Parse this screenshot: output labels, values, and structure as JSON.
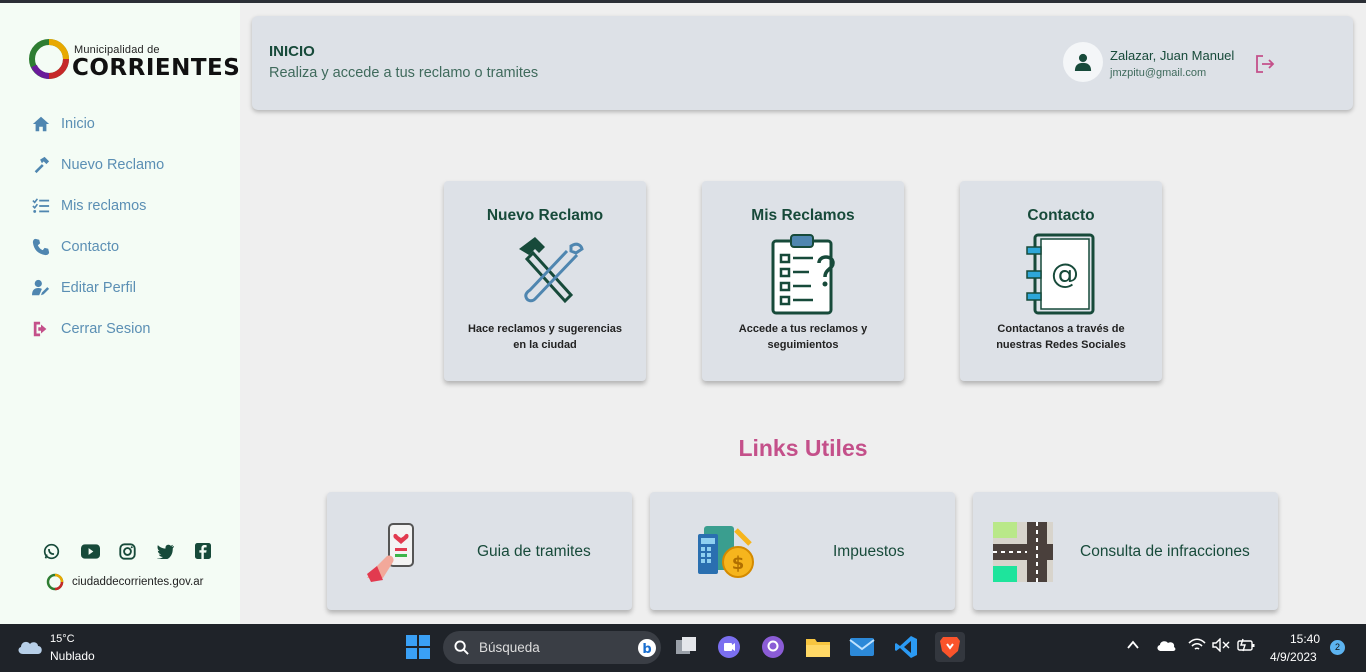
{
  "logo": {
    "small": "Municipalidad de",
    "big": "CORRIENTES"
  },
  "sidebar": {
    "items": [
      {
        "label": "Inicio",
        "icon": "home-icon"
      },
      {
        "label": "Nuevo Reclamo",
        "icon": "hammer-icon"
      },
      {
        "label": "Mis reclamos",
        "icon": "list-check-icon"
      },
      {
        "label": "Contacto",
        "icon": "phone-icon"
      },
      {
        "label": "Editar Perfil",
        "icon": "user-edit-icon"
      },
      {
        "label": "Cerrar Sesion",
        "icon": "sign-out-icon"
      }
    ],
    "website": "ciudaddecorrientes.gov.ar"
  },
  "header": {
    "title": "INICIO",
    "subtitle": "Realiza y accede a tus reclamo o tramites",
    "user_name": "Zalazar, Juan Manuel",
    "user_email": "jmzpitu@gmail.com"
  },
  "cards": [
    {
      "title": "Nuevo Reclamo",
      "desc": "Hace reclamos y sugerencias en la ciudad",
      "icon": "tools-icon"
    },
    {
      "title": "Mis Reclamos",
      "desc": "Accede a tus reclamos y seguimientos",
      "icon": "clipboard-icon"
    },
    {
      "title": "Contacto",
      "desc": "Contactanos a través de nuestras Redes Sociales",
      "icon": "address-book-icon"
    }
  ],
  "links": {
    "title": "Links Utiles",
    "items": [
      {
        "label": "Guia de tramites",
        "icon": "phone-hand-icon"
      },
      {
        "label": "Impuestos",
        "icon": "taxes-icon"
      },
      {
        "label": "Consulta de infracciones",
        "icon": "map-road-icon"
      }
    ]
  },
  "taskbar": {
    "temp": "15°C",
    "weather": "Nublado",
    "search_placeholder": "Búsqueda",
    "time": "15:40",
    "date": "4/9/2023",
    "notifications": "2"
  },
  "colors": {
    "accent": "#c4508a",
    "brand_green": "#174a3a",
    "menu_blue": "#5b8fb4"
  }
}
